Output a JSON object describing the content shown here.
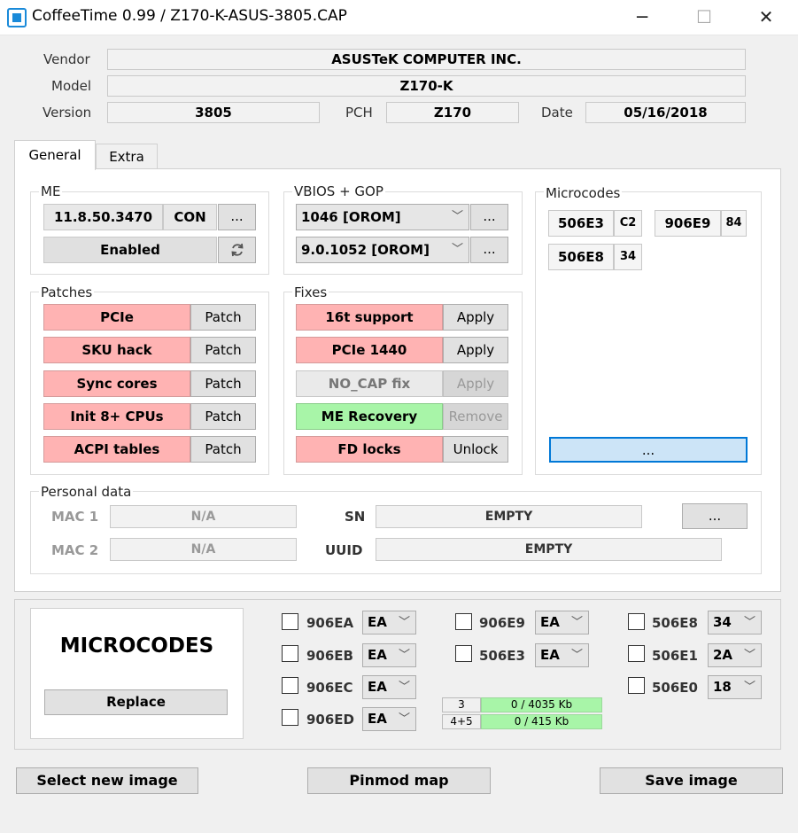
{
  "window": {
    "title": "CoffeeTime 0.99  /  Z170-K-ASUS-3805.CAP",
    "minimize": "─",
    "maximize": "☐",
    "close": "✕"
  },
  "info": {
    "vendor_label": "Vendor",
    "vendor": "ASUSTeK COMPUTER INC.",
    "model_label": "Model",
    "model": "Z170-K",
    "version_label": "Version",
    "version": "3805",
    "pch_label": "PCH",
    "pch": "Z170",
    "date_label": "Date",
    "date": "05/16/2018"
  },
  "tabs": [
    {
      "label": "General"
    },
    {
      "label": "Extra"
    }
  ],
  "me": {
    "label": "ME",
    "version": "11.8.50.3470",
    "type": "CON",
    "more": "...",
    "state": "Enabled",
    "refresh_icon": "refresh-icon"
  },
  "vbios": {
    "label": "VBIOS + GOP",
    "vbios": "1046 [OROM]",
    "gop": "9.0.1052 [OROM]",
    "more": "..."
  },
  "microcodes": {
    "label": "Microcodes",
    "items": [
      {
        "cpuid": "506E3",
        "rev": "C2"
      },
      {
        "cpuid": "906E9",
        "rev": "84"
      },
      {
        "cpuid": "506E8",
        "rev": "34"
      }
    ],
    "more": "..."
  },
  "patches": {
    "label": "Patches",
    "items": [
      {
        "name": "PCIe",
        "action": "Patch"
      },
      {
        "name": "SKU hack",
        "action": "Patch"
      },
      {
        "name": "Sync cores",
        "action": "Patch"
      },
      {
        "name": "Init 8+ CPUs",
        "action": "Patch"
      },
      {
        "name": "ACPI tables",
        "action": "Patch"
      }
    ]
  },
  "fixes": {
    "label": "Fixes",
    "items": [
      {
        "name": "16t support",
        "action": "Apply",
        "status": "pink"
      },
      {
        "name": "PCIe 1440",
        "action": "Apply",
        "status": "pink"
      },
      {
        "name": "NO_CAP fix",
        "action": "Apply",
        "status": "disabled"
      },
      {
        "name": "ME Recovery",
        "action": "Remove",
        "status": "green"
      },
      {
        "name": "FD locks",
        "action": "Unlock",
        "status": "pink"
      }
    ]
  },
  "personal": {
    "label": "Personal data",
    "mac1_label": "MAC 1",
    "mac1": "N/A",
    "mac2_label": "MAC 2",
    "mac2": "N/A",
    "sn_label": "SN",
    "sn": "EMPTY",
    "uuid_label": "UUID",
    "uuid": "EMPTY",
    "more": "..."
  },
  "replace": {
    "title": "MICROCODES",
    "button": "Replace"
  },
  "mc_select": {
    "col1": [
      {
        "cpuid": "906EA",
        "value": "EA"
      },
      {
        "cpuid": "906EB",
        "value": "EA"
      },
      {
        "cpuid": "906EC",
        "value": "EA"
      },
      {
        "cpuid": "906ED",
        "value": "EA"
      }
    ],
    "col2": [
      {
        "cpuid": "906E9",
        "value": "EA"
      },
      {
        "cpuid": "506E3",
        "value": "EA"
      }
    ],
    "col3": [
      {
        "cpuid": "506E8",
        "value": "34"
      },
      {
        "cpuid": "506E1",
        "value": "2A"
      },
      {
        "cpuid": "506E0",
        "value": "18"
      }
    ]
  },
  "usage": [
    {
      "slot": "3",
      "value": "0 / 4035 Kb"
    },
    {
      "slot": "4+5",
      "value": "0 / 415 Kb"
    }
  ],
  "bottom": {
    "select_new": "Select new image",
    "pinmod": "Pinmod map",
    "save": "Save image"
  }
}
